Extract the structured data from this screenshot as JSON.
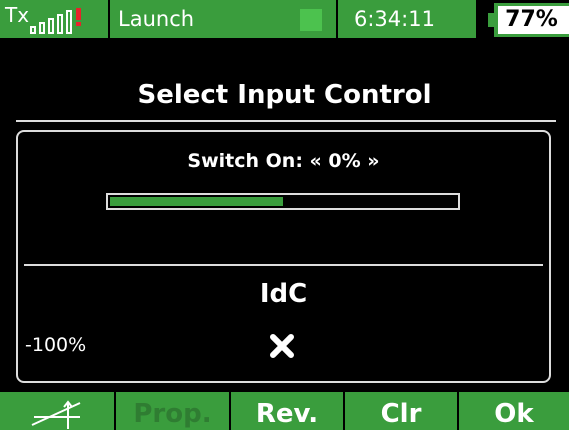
{
  "statusbar": {
    "tx_label": "Tx",
    "model_name": "Launch",
    "clock": "6:34:11",
    "battery_percent": "77%",
    "battery_level": 0.77,
    "signal_bars": 4
  },
  "title": "Select Input Control",
  "panel": {
    "switch_label": "Switch On: « 0% »",
    "switch_value_fraction": 0.5,
    "control_name": "IdC",
    "control_min": "-100%",
    "control_icon": "x-icon"
  },
  "buttons": {
    "trim_icon": "trim-icon",
    "prop": "Prop.",
    "rev": "Rev.",
    "clr": "Clr",
    "ok": "Ok"
  },
  "colors": {
    "accent": "#3a9d3d",
    "indicator": "#4cc24e",
    "alert": "#e8232a",
    "background": "#000000"
  }
}
